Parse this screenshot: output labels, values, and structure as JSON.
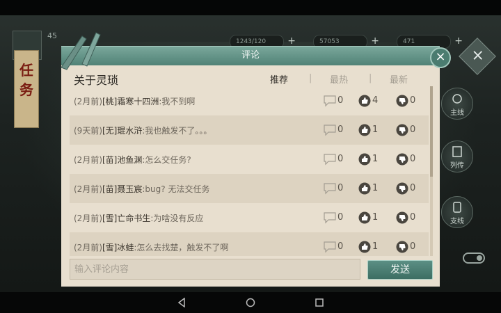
{
  "background": {
    "level": "45",
    "quest_banner": "任务",
    "resources": [
      "1243/120",
      "57053",
      "471"
    ],
    "side_menu": [
      "主线",
      "列传",
      "支线"
    ]
  },
  "dialog": {
    "title": "评论",
    "topic": "关于灵琐",
    "sort_tabs": [
      "推荐",
      "最热",
      "最新"
    ],
    "active_tab": "推荐",
    "comments": [
      {
        "time": "(2月前)",
        "name": "[桃]霜寒十四洲",
        "text": ":我不到啊",
        "replies": "0",
        "likes": "4",
        "dislikes": "0"
      },
      {
        "time": "(9天前)",
        "name": "[无]琨水浒",
        "text": ":我也触发不了。。。",
        "replies": "0",
        "likes": "1",
        "dislikes": "0"
      },
      {
        "time": "(2月前)",
        "name": "[苗]池鱼渊",
        "text": ":怎么交任务?",
        "replies": "0",
        "likes": "1",
        "dislikes": "0"
      },
      {
        "time": "(2月前)",
        "name": "[苗]聂玉宸",
        "text": ":bug? 无法交任务",
        "replies": "0",
        "likes": "1",
        "dislikes": "0"
      },
      {
        "time": "(2月前)",
        "name": "[雪]亡命书生",
        "text": ":为啥没有反应",
        "replies": "0",
        "likes": "1",
        "dislikes": "0"
      },
      {
        "time": "(2月前)",
        "name": "[雪]冰蛙",
        "text": ":怎么去找楚，触发不了啊",
        "replies": "0",
        "likes": "1",
        "dislikes": "0"
      }
    ],
    "input_placeholder": "输入评论内容",
    "send_label": "发送",
    "close_symbol": "×"
  },
  "colors": {
    "accent": "#4f8175",
    "panel": "#e8dfcf"
  }
}
